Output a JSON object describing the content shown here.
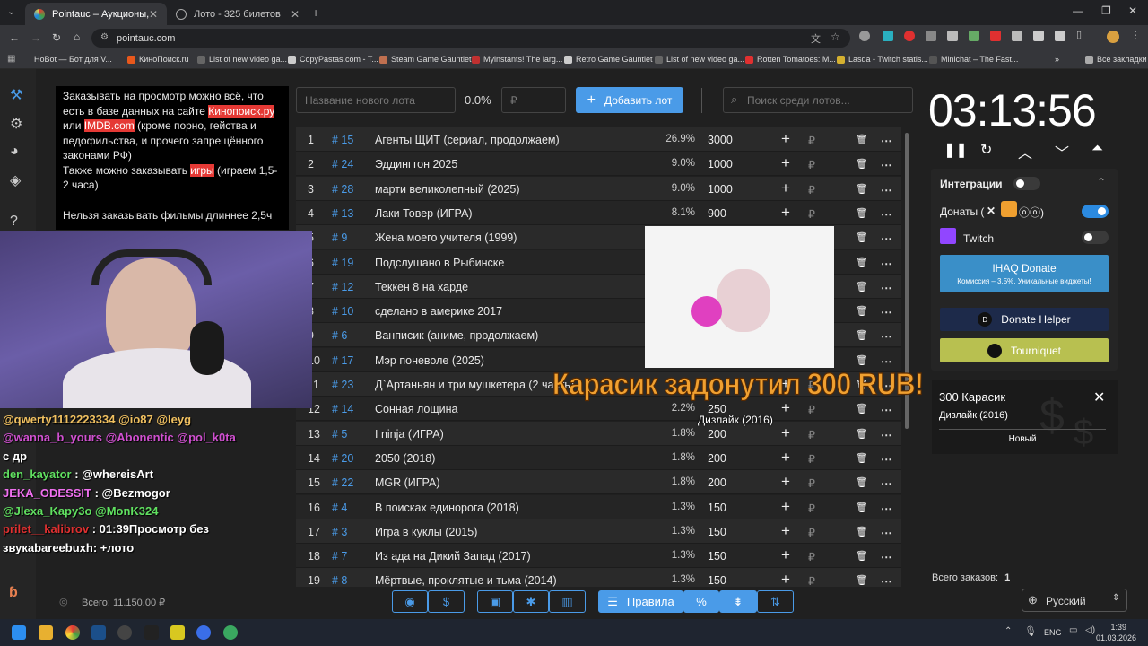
{
  "browser": {
    "tabs": [
      {
        "title": "Pointauc – Аукционы, лотерея"
      },
      {
        "title": "Лото - 325 билетов"
      }
    ],
    "url": "pointauc.com",
    "bookmarks": [
      "HoBot — Бот для V...",
      "КиноПоиск.ru",
      "List of new video ga...",
      "CopyPastas.com - T...",
      "Steam Game Gauntlet",
      "Myinstants! The larg...",
      "Retro Game Gauntlet",
      "List of new video ga...",
      "Rotten Tomatoes: M...",
      "Lasqa - Twitch statis...",
      "Minichat – The Fast..."
    ],
    "all_bookmarks": "Все закладки"
  },
  "rules": {
    "p1a": "Заказывать на просмотр можно всё, что есть в базе данных на сайте ",
    "p1link1": "Кинопоиск.ру",
    "p1b": " или ",
    "p1link2": "IMDB.com",
    "p1c": " (кроме порно, гейства и педофильства, и прочего запрещённого законами РФ)",
    "p2a": "Также можно заказывать ",
    "p2link": "игры",
    "p2b": " (играем 1,5-2 часа)",
    "p3": "Нельзя заказывать фильмы длиннее 2,5ч"
  },
  "controls": {
    "new_lot_placeholder": "Название нового лота",
    "percent": "0.0%",
    "amount_placeholder": "₽",
    "add_label": "Добавить лот",
    "search_placeholder": "Поиск среди лотов..."
  },
  "lots": [
    {
      "n": "1",
      "id": "# 15",
      "name": "Агенты ЩИТ (сериал, продолжаем)",
      "pct": "26.9%",
      "amount": "3000"
    },
    {
      "n": "2",
      "id": "# 24",
      "name": "Эддингтон 2025",
      "pct": "9.0%",
      "amount": "1000"
    },
    {
      "n": "3",
      "id": "# 28",
      "name": "марти великолепный (2025)",
      "pct": "9.0%",
      "amount": "1000"
    },
    {
      "n": "4",
      "id": "# 13",
      "name": "Лаки Товер (ИГРА)",
      "pct": "8.1%",
      "amount": "900"
    },
    {
      "n": "5",
      "id": "# 9",
      "name": "Жена моего учителя (1999)",
      "pct": "",
      "amount": ""
    },
    {
      "n": "6",
      "id": "# 19",
      "name": "Подслушано в Рыбинске",
      "pct": "",
      "amount": ""
    },
    {
      "n": "7",
      "id": "# 12",
      "name": "Теккен 8 на харде",
      "pct": "",
      "amount": ""
    },
    {
      "n": "8",
      "id": "# 10",
      "name": "сделано в америке 2017",
      "pct": "",
      "amount": ""
    },
    {
      "n": "9",
      "id": "# 6",
      "name": "Ванписик (аниме, продолжаем)",
      "pct": "",
      "amount": ""
    },
    {
      "n": "10",
      "id": "# 17",
      "name": "Мэр поневоле (2025)",
      "pct": "",
      "amount": ""
    },
    {
      "n": "11",
      "id": "# 23",
      "name": "Д`Артаньян и три мушкетера (2 часть)",
      "pct": "",
      "amount": ""
    },
    {
      "n": "12",
      "id": "# 14",
      "name": "Сонная лощина",
      "pct": "2.2%",
      "amount": "250"
    },
    {
      "n": "13",
      "id": "# 5",
      "name": "I ninja (ИГРА)",
      "pct": "1.8%",
      "amount": "200"
    },
    {
      "n": "14",
      "id": "# 20",
      "name": "2050 (2018)",
      "pct": "1.8%",
      "amount": "200"
    },
    {
      "n": "15",
      "id": "# 22",
      "name": "MGR (ИГРА)",
      "pct": "1.8%",
      "amount": "200"
    },
    {
      "n": "16",
      "id": "# 4",
      "name": "В поисках единорога (2018)",
      "pct": "1.3%",
      "amount": "150"
    },
    {
      "n": "17",
      "id": "# 3",
      "name": "Игра в куклы (2015)",
      "pct": "1.3%",
      "amount": "150"
    },
    {
      "n": "18",
      "id": "# 7",
      "name": "Из ада на Дикий Запад (2017)",
      "pct": "1.3%",
      "amount": "150"
    },
    {
      "n": "19",
      "id": "# 8",
      "name": "Мёртвые, проклятые и тьма (2014)",
      "pct": "1.3%",
      "amount": "150"
    }
  ],
  "alert": {
    "text": "Карасик задонутил 300 RUB!",
    "sub": "Дизлайк (2016)"
  },
  "chat": [
    {
      "user": "@qwerty1112223334",
      "msg": "@io87 @leyg",
      "c": "u1"
    },
    {
      "user": "@wanna_b_yours",
      "msg": "@Abonentic @pol_k0ta",
      "c": "u2"
    },
    {
      "user": "",
      "msg": "с др",
      "c": "u1"
    },
    {
      "user": "den_kayator",
      "msg": ": @whereisArt",
      "c": "u3"
    },
    {
      "user": "JEKA_ODESSIT",
      "msg": ": @Bezmogor",
      "c": "u4"
    },
    {
      "user": "@Jlexa_Kapy3o",
      "msg": "@MonK324",
      "c": "u3"
    },
    {
      "user": "prilet__kalibrov",
      "msg": ": 01:39Просмотр без",
      "c": "u5"
    },
    {
      "user": "",
      "msg": "звукabareebuxh: +лото",
      "c": "u1"
    }
  ],
  "total": "Всего: 11.150,00 ₽",
  "timer": "03:13:56",
  "integrations": {
    "title": "Интеграции",
    "donations": "Донаты (",
    "twitch": "Twitch",
    "ihaq": "IHAQ Donate",
    "ihaq_sub": "Комиссия – 3,5%. Уникальные виджеты!",
    "donate_helper": "Donate Helper",
    "tourniquet": "Tourniquet"
  },
  "card": {
    "amount": "300 Карасик",
    "lot": "Дизлайк (2016)",
    "tag": "Новый"
  },
  "orders": {
    "label": "Всего заказов:",
    "count": "1"
  },
  "language": "Русский",
  "bottom": {
    "rules": "Правила"
  },
  "clock": {
    "time": "1:39",
    "date": "01.03.2026",
    "lang": "ENG"
  },
  "colors": {
    "accent": "#4a9be8",
    "highlight": "#e53935",
    "alert": "#f0a030"
  }
}
